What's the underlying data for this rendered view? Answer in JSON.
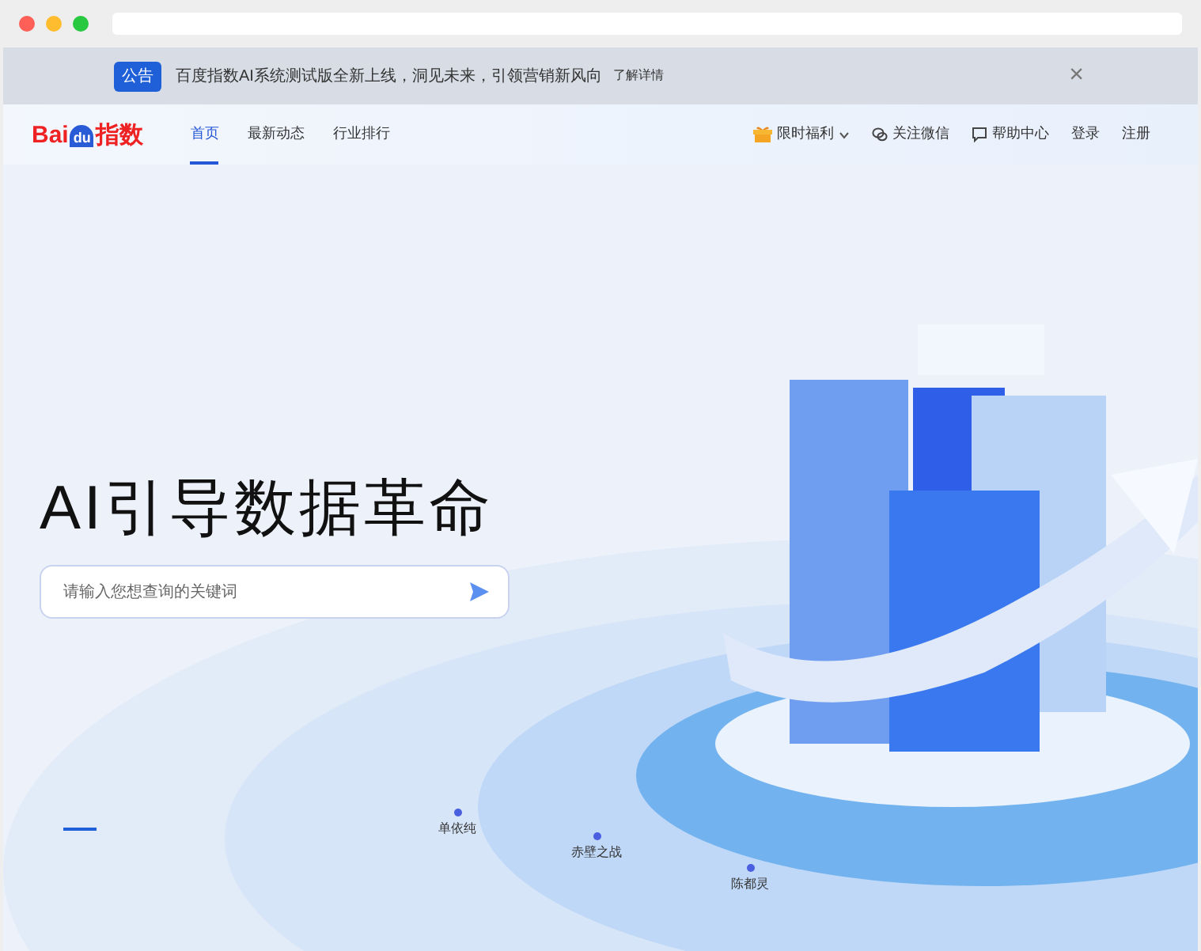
{
  "announcement": {
    "badge": "公告",
    "text": "百度指数AI系统测试版全新上线，洞见未来，引领营销新风向",
    "link": "了解详情",
    "close": "×"
  },
  "nav": {
    "logo": {
      "brand": "Bai",
      "paw": "du",
      "product": "指数"
    },
    "items": [
      {
        "label": "首页",
        "selected": true
      },
      {
        "label": "最新动态",
        "selected": false
      },
      {
        "label": "行业排行",
        "selected": false
      }
    ],
    "actions": [
      {
        "kind": "promo",
        "label": "限时福利"
      },
      {
        "kind": "wechat",
        "label": "关注微信"
      },
      {
        "kind": "help",
        "label": "帮助中心"
      },
      {
        "kind": "plain",
        "label": "登录"
      },
      {
        "kind": "plain",
        "label": "注册"
      }
    ]
  },
  "hero": {
    "title": "AI引导数据革命",
    "search": {
      "placeholder": "请输入您想查询的关键词"
    },
    "keywords": [
      {
        "label": "单依纯"
      },
      {
        "label": "赤壁之战"
      },
      {
        "label": "陈都灵"
      }
    ]
  }
}
